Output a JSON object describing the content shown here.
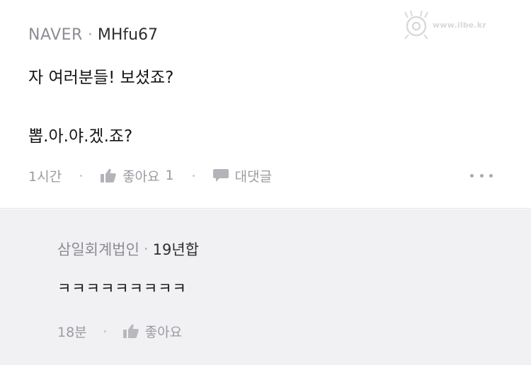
{
  "comment": {
    "source": "NAVER",
    "separator": "·",
    "nickname": "MHfu67",
    "lines": [
      "자 여러분들! 보셨죠?",
      "뽑.아.야.겠.죠?"
    ],
    "time": "1시간",
    "like_label": "좋아요",
    "like_count": "1",
    "reply_label": "대댓글",
    "like_icon": "thumbs-up-icon",
    "reply_icon": "speech-bubble-icon",
    "more_icon": "more-dots-icon"
  },
  "reply": {
    "source": "삼일회계법인",
    "separator": "·",
    "nickname": "19년합",
    "text": "ㅋㅋㅋㅋㅋㅋㅋㅋㅋ",
    "time": "18분",
    "like_label": "좋아요",
    "like_icon": "thumbs-up-icon"
  },
  "watermark": {
    "text": "www.ilbe.kr",
    "icon": "mascot-logo-icon"
  },
  "colors": {
    "background": "#ffffff",
    "reply_background": "#f1f1f3",
    "muted_text": "#9b9ba3",
    "main_text": "#151515"
  }
}
